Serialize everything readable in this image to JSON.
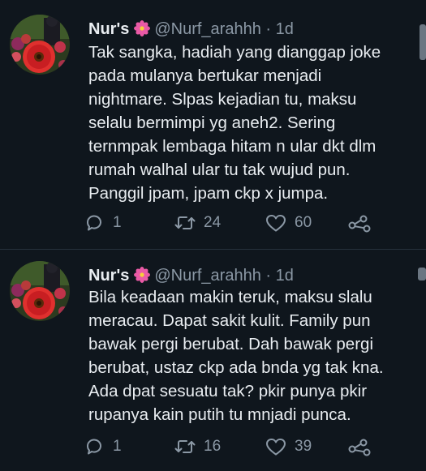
{
  "tweets": [
    {
      "author": {
        "display_name": "Nur's",
        "handle": "@Nurf_arahhh",
        "avatar_icon": "avatar-flower-photo",
        "name_emoji": "pink-flower-icon"
      },
      "separator": "·",
      "timestamp": "1d",
      "body_lines": [
        "Tak sangka, hadiah yang dianggap joke",
        "pada mulanya bertukar menjadi",
        "nightmare. Slpas kejadian tu, maksu",
        "selalu bermimpi yg aneh2. Sering",
        "ternmpak lembaga hitam n ular dkt dlm",
        "rumah walhal ular tu tak wujud pun.",
        "Panggil jpam, jpam ckp x jumpa."
      ],
      "actions": {
        "reply_count": "1",
        "retweet_count": "24",
        "like_count": "60"
      }
    },
    {
      "author": {
        "display_name": "Nur's",
        "handle": "@Nurf_arahhh",
        "avatar_icon": "avatar-flower-photo",
        "name_emoji": "pink-flower-icon"
      },
      "separator": "·",
      "timestamp": "1d",
      "body_lines": [
        "Bila keadaan makin teruk, maksu slalu",
        "meracau. Dapat sakit kulit. Family pun",
        "bawak pergi berubat. Dah bawak pergi",
        "berubat, ustaz ckp ada bnda yg tak kna.",
        "Ada dpat sesuatu tak? pkir punya pkir",
        "rupanya kain putih tu mnjadi punca."
      ],
      "actions": {
        "reply_count": "1",
        "retweet_count": "16",
        "like_count": "39"
      }
    }
  ],
  "colors": {
    "background": "#0f161d",
    "primary_text": "#e9edf1",
    "secondary_text": "#8b98a5",
    "divider": "#26323c",
    "emoji_pink": "#ea5aa6"
  }
}
